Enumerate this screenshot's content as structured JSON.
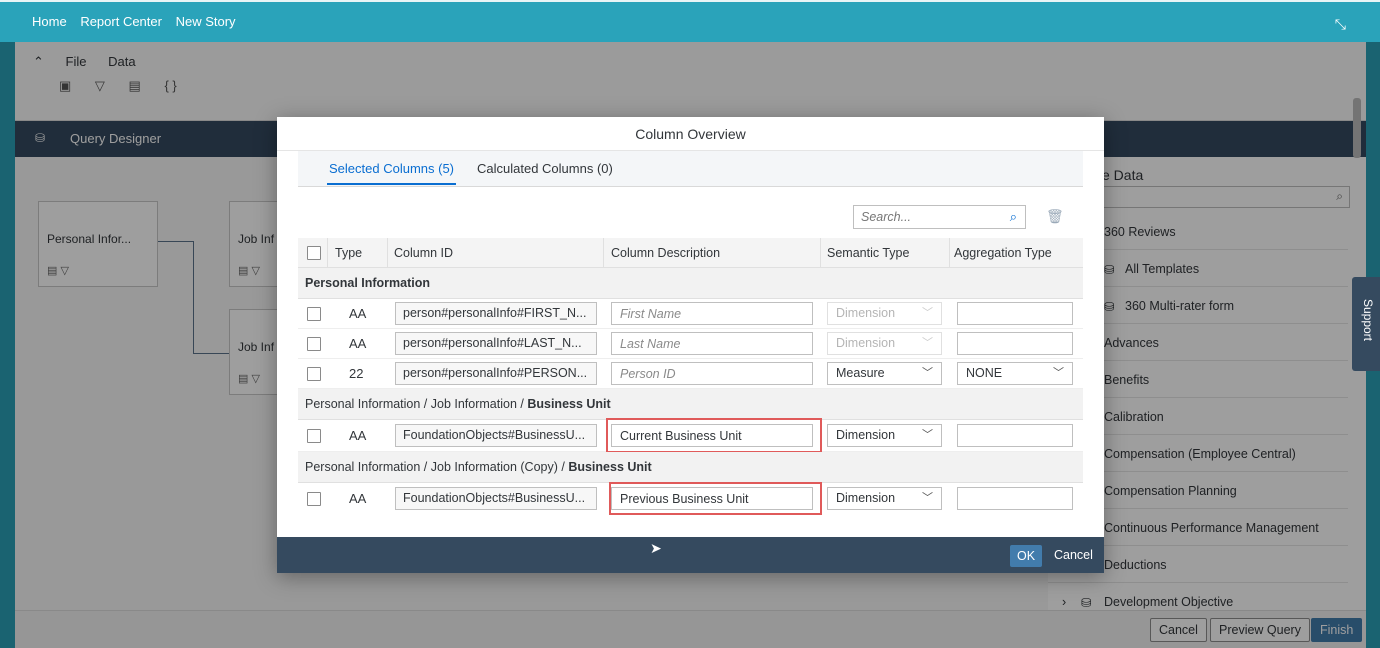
{
  "shell": {
    "breadcrumbs": [
      "Home",
      "Report Center",
      "New Story"
    ]
  },
  "toolbar": {
    "menu": [
      "File",
      "Data"
    ],
    "collapse_icon": "chevron-up-icon"
  },
  "query_designer": {
    "title": "Query Designer"
  },
  "canvas": {
    "nodes": [
      {
        "label": "Personal Infor..."
      },
      {
        "label": "Job Inf"
      },
      {
        "label": "Job Inf"
      }
    ]
  },
  "right_panel": {
    "title": "e Data",
    "items": [
      "360 Reviews",
      "All Templates",
      "360 Multi-rater form",
      "Advances",
      "Benefits",
      "Calibration",
      "Compensation (Employee Central)",
      "Compensation Planning",
      "Continuous Performance Management",
      "Deductions",
      "Development Objective"
    ]
  },
  "footer": {
    "cancel": "Cancel",
    "preview": "Preview Query",
    "finish": "Finish"
  },
  "support": {
    "label": "Support"
  },
  "dialog": {
    "title": "Column Overview",
    "tabs": [
      "Selected Columns (5)",
      "Calculated Columns (0)"
    ],
    "search_placeholder": "Search...",
    "headers": [
      "Type",
      "Column ID",
      "Column Description",
      "Semantic Type",
      "Aggregation Type"
    ],
    "groups": [
      {
        "label": "Personal Information",
        "bold": ""
      },
      {
        "label": "Personal Information / Job Information / ",
        "bold": "Business Unit"
      },
      {
        "label": "Personal Information / Job Information (Copy) / ",
        "bold": "Business Unit"
      }
    ],
    "rows": [
      {
        "type": "AA",
        "id": "person#personalInfo#FIRST_N...",
        "desc_value": "",
        "desc_placeholder": "First Name",
        "semantic": "Dimension",
        "aggregation": ""
      },
      {
        "type": "AA",
        "id": "person#personalInfo#LAST_N...",
        "desc_value": "",
        "desc_placeholder": "Last Name",
        "semantic": "Dimension",
        "aggregation": ""
      },
      {
        "type": "22",
        "id": "person#personalInfo#PERSON...",
        "desc_value": "",
        "desc_placeholder": "Person ID",
        "semantic": "Measure",
        "aggregation": "NONE"
      },
      {
        "type": "AA",
        "id": "FoundationObjects#BusinessU...",
        "desc_value": "Current Business Unit",
        "desc_placeholder": "",
        "semantic": "Dimension",
        "aggregation": ""
      },
      {
        "type": "AA",
        "id": "FoundationObjects#BusinessU...",
        "desc_value": "Previous Business Unit",
        "desc_placeholder": "",
        "semantic": "Dimension",
        "aggregation": ""
      }
    ],
    "ok": "OK",
    "cancel": "Cancel"
  },
  "colors": {
    "shell": "#2aa3ba",
    "dark_bar": "#354a5f",
    "accent": "#0a6ed1",
    "button": "#427cac",
    "highlight": "#e05a5a"
  }
}
